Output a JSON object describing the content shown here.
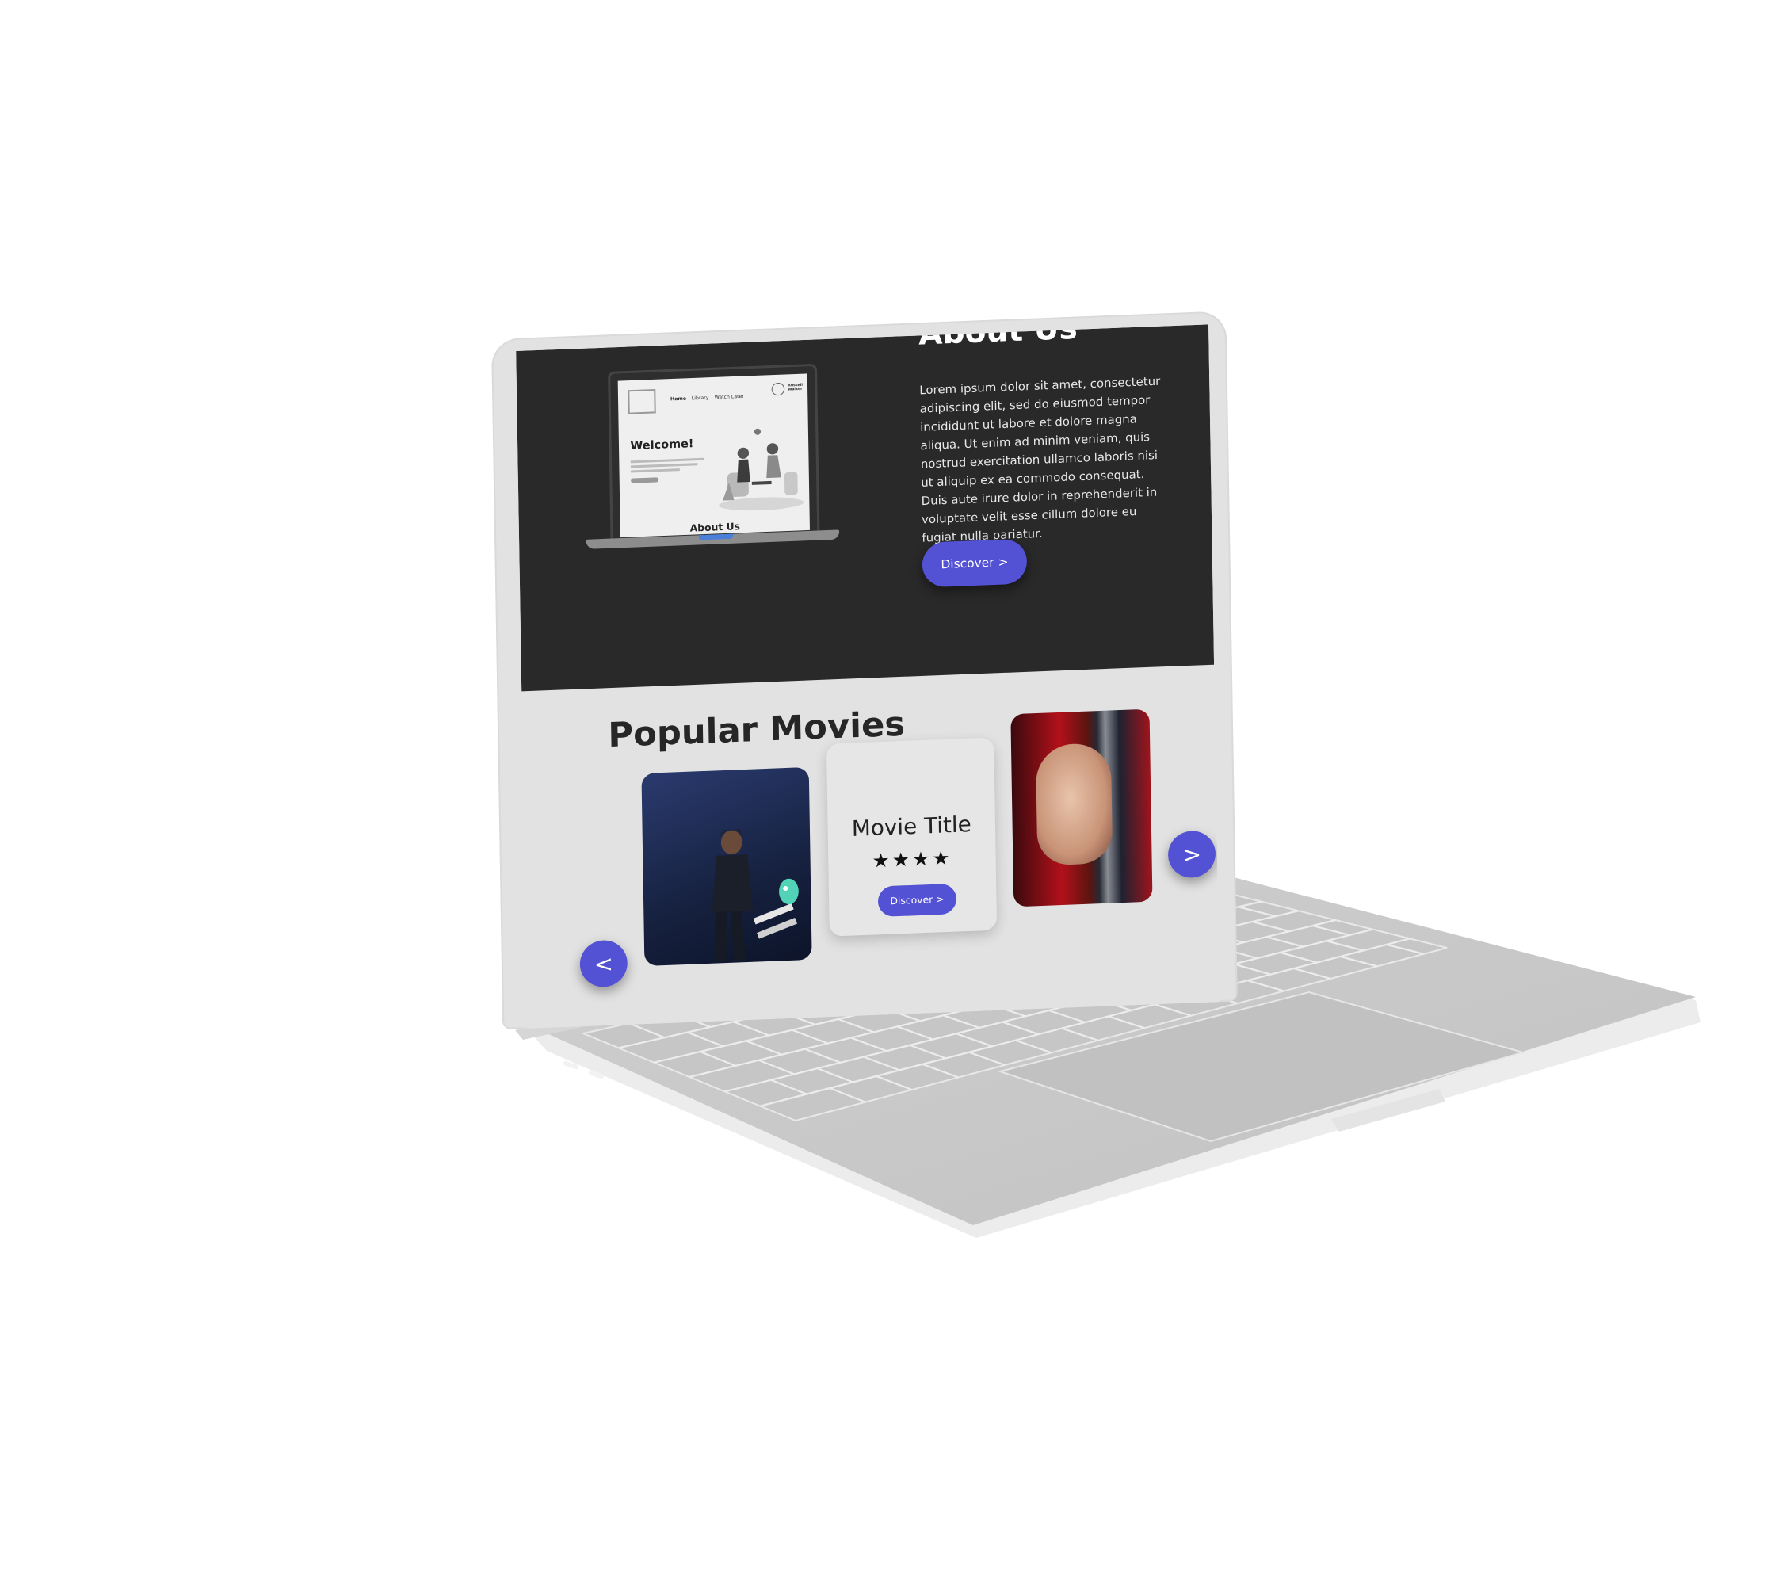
{
  "about": {
    "title": "About Us",
    "text": "Lorem ipsum dolor sit amet, consectetur adipiscing elit, sed do eiusmod tempor incididunt ut labore et dolore magna aliqua. Ut enim ad minim veniam, quis nostrud exercitation ullamco laboris nisi ut aliquip ex ea commodo consequat. Duis aute irure dolor in reprehenderit in voluptate velit esse cillum dolore eu fugiat nulla pariatur.",
    "discover_label": "Discover >",
    "mini_preview": {
      "nav": [
        "Home",
        "Library",
        "Watch Later"
      ],
      "user_name": "Russell Walker",
      "welcome": "Welcome!",
      "about_label": "About Us"
    }
  },
  "popular": {
    "title": "Popular Movies",
    "featured": {
      "title": "Movie Title",
      "stars": "★★★★",
      "discover_label": "Discover >"
    },
    "prev_label": "<",
    "next_label": ">"
  },
  "colors": {
    "accent": "#5351d4",
    "dark_section": "#292929",
    "light_section": "#e2e2e2"
  }
}
